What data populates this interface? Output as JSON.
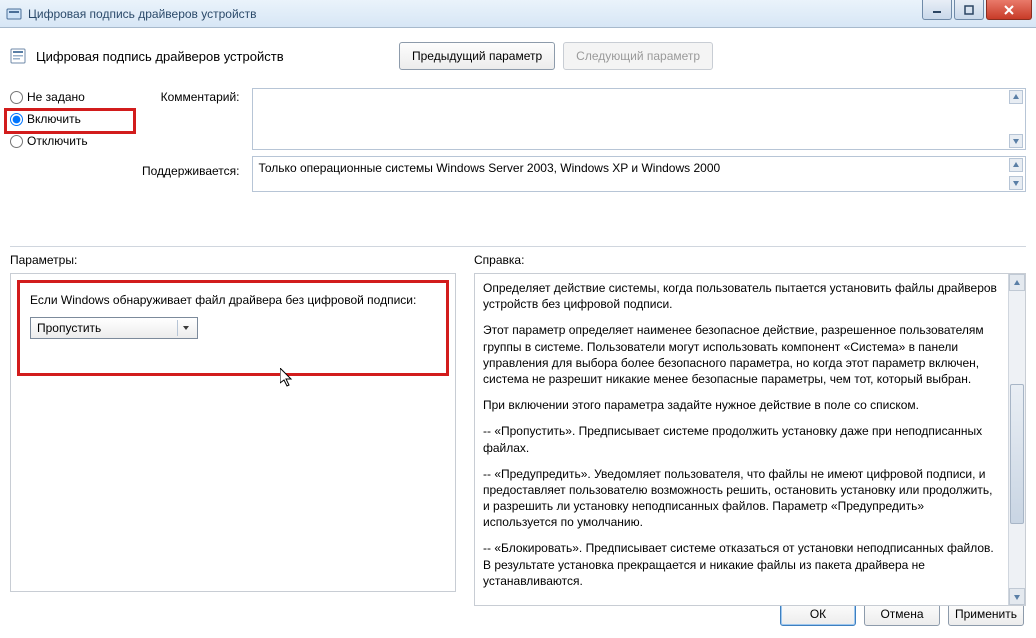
{
  "window": {
    "title": "Цифровая подпись драйверов устройств"
  },
  "header": {
    "policy_title": "Цифровая подпись драйверов устройств",
    "prev_button": "Предыдущий параметр",
    "next_button": "Следующий параметр"
  },
  "radios": {
    "not_configured": "Не задано",
    "enabled": "Включить",
    "disabled": "Отключить",
    "selected": "enabled"
  },
  "meta": {
    "comment_label": "Комментарий:",
    "comment_value": "",
    "supported_label": "Поддерживается:",
    "supported_value": "Только операционные системы Windows Server 2003, Windows XP и Windows 2000"
  },
  "params": {
    "section": "Параметры:",
    "prompt": "Если Windows обнаруживает файл драйвера без цифровой подписи:",
    "dropdown_value": "Пропустить"
  },
  "help": {
    "section": "Справка:",
    "p1": "Определяет действие системы, когда пользователь пытается установить файлы драйверов устройств без цифровой подписи.",
    "p2": "Этот параметр определяет наименее безопасное действие, разрешенное пользователям группы в системе. Пользователи могут использовать компонент «Система» в панели управления для выбора более безопасного параметра, но когда этот параметр включен, система не разрешит никакие менее безопасные параметры, чем тот, который выбран.",
    "p3": "При включении этого параметра задайте нужное действие в поле со списком.",
    "p4": "--   «Пропустить». Предписывает системе продолжить установку даже при неподписанных файлах.",
    "p5": "--   «Предупредить». Уведомляет пользователя, что файлы не имеют цифровой подписи, и предоставляет пользователю возможность решить, остановить установку или продолжить, и разрешить ли установку неподписанных файлов. Параметр «Предупредить» используется по умолчанию.",
    "p6": "--   «Блокировать». Предписывает системе отказаться от установки неподписанных файлов. В результате установка прекращается и никакие файлы из пакета драйвера не устанавливаются."
  },
  "footer": {
    "ok": "ОК",
    "cancel": "Отмена",
    "apply": "Применить"
  }
}
